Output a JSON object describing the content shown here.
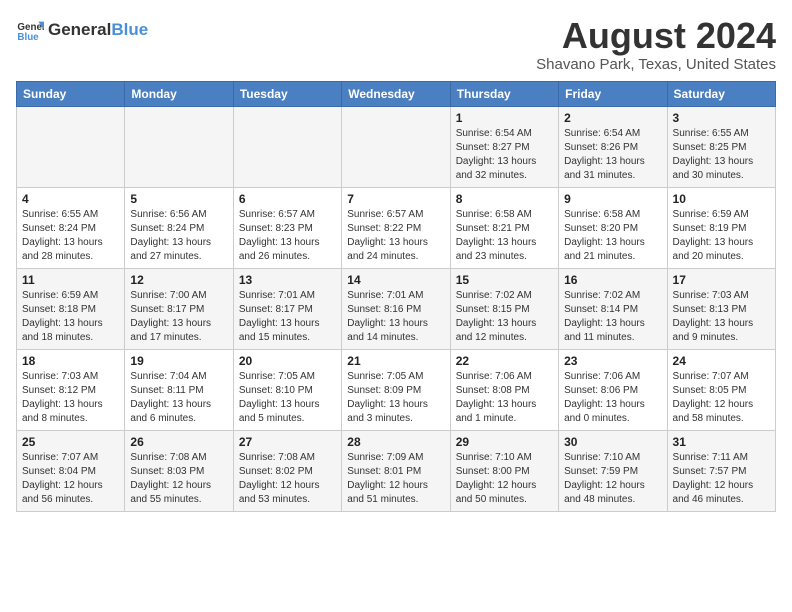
{
  "header": {
    "logo_general": "General",
    "logo_blue": "Blue",
    "title": "August 2024",
    "subtitle": "Shavano Park, Texas, United States"
  },
  "calendar": {
    "days_of_week": [
      "Sunday",
      "Monday",
      "Tuesday",
      "Wednesday",
      "Thursday",
      "Friday",
      "Saturday"
    ],
    "weeks": [
      [
        {
          "day": "",
          "detail": ""
        },
        {
          "day": "",
          "detail": ""
        },
        {
          "day": "",
          "detail": ""
        },
        {
          "day": "",
          "detail": ""
        },
        {
          "day": "1",
          "detail": "Sunrise: 6:54 AM\nSunset: 8:27 PM\nDaylight: 13 hours\nand 32 minutes."
        },
        {
          "day": "2",
          "detail": "Sunrise: 6:54 AM\nSunset: 8:26 PM\nDaylight: 13 hours\nand 31 minutes."
        },
        {
          "day": "3",
          "detail": "Sunrise: 6:55 AM\nSunset: 8:25 PM\nDaylight: 13 hours\nand 30 minutes."
        }
      ],
      [
        {
          "day": "4",
          "detail": "Sunrise: 6:55 AM\nSunset: 8:24 PM\nDaylight: 13 hours\nand 28 minutes."
        },
        {
          "day": "5",
          "detail": "Sunrise: 6:56 AM\nSunset: 8:24 PM\nDaylight: 13 hours\nand 27 minutes."
        },
        {
          "day": "6",
          "detail": "Sunrise: 6:57 AM\nSunset: 8:23 PM\nDaylight: 13 hours\nand 26 minutes."
        },
        {
          "day": "7",
          "detail": "Sunrise: 6:57 AM\nSunset: 8:22 PM\nDaylight: 13 hours\nand 24 minutes."
        },
        {
          "day": "8",
          "detail": "Sunrise: 6:58 AM\nSunset: 8:21 PM\nDaylight: 13 hours\nand 23 minutes."
        },
        {
          "day": "9",
          "detail": "Sunrise: 6:58 AM\nSunset: 8:20 PM\nDaylight: 13 hours\nand 21 minutes."
        },
        {
          "day": "10",
          "detail": "Sunrise: 6:59 AM\nSunset: 8:19 PM\nDaylight: 13 hours\nand 20 minutes."
        }
      ],
      [
        {
          "day": "11",
          "detail": "Sunrise: 6:59 AM\nSunset: 8:18 PM\nDaylight: 13 hours\nand 18 minutes."
        },
        {
          "day": "12",
          "detail": "Sunrise: 7:00 AM\nSunset: 8:17 PM\nDaylight: 13 hours\nand 17 minutes."
        },
        {
          "day": "13",
          "detail": "Sunrise: 7:01 AM\nSunset: 8:17 PM\nDaylight: 13 hours\nand 15 minutes."
        },
        {
          "day": "14",
          "detail": "Sunrise: 7:01 AM\nSunset: 8:16 PM\nDaylight: 13 hours\nand 14 minutes."
        },
        {
          "day": "15",
          "detail": "Sunrise: 7:02 AM\nSunset: 8:15 PM\nDaylight: 13 hours\nand 12 minutes."
        },
        {
          "day": "16",
          "detail": "Sunrise: 7:02 AM\nSunset: 8:14 PM\nDaylight: 13 hours\nand 11 minutes."
        },
        {
          "day": "17",
          "detail": "Sunrise: 7:03 AM\nSunset: 8:13 PM\nDaylight: 13 hours\nand 9 minutes."
        }
      ],
      [
        {
          "day": "18",
          "detail": "Sunrise: 7:03 AM\nSunset: 8:12 PM\nDaylight: 13 hours\nand 8 minutes."
        },
        {
          "day": "19",
          "detail": "Sunrise: 7:04 AM\nSunset: 8:11 PM\nDaylight: 13 hours\nand 6 minutes."
        },
        {
          "day": "20",
          "detail": "Sunrise: 7:05 AM\nSunset: 8:10 PM\nDaylight: 13 hours\nand 5 minutes."
        },
        {
          "day": "21",
          "detail": "Sunrise: 7:05 AM\nSunset: 8:09 PM\nDaylight: 13 hours\nand 3 minutes."
        },
        {
          "day": "22",
          "detail": "Sunrise: 7:06 AM\nSunset: 8:08 PM\nDaylight: 13 hours\nand 1 minute."
        },
        {
          "day": "23",
          "detail": "Sunrise: 7:06 AM\nSunset: 8:06 PM\nDaylight: 13 hours\nand 0 minutes."
        },
        {
          "day": "24",
          "detail": "Sunrise: 7:07 AM\nSunset: 8:05 PM\nDaylight: 12 hours\nand 58 minutes."
        }
      ],
      [
        {
          "day": "25",
          "detail": "Sunrise: 7:07 AM\nSunset: 8:04 PM\nDaylight: 12 hours\nand 56 minutes."
        },
        {
          "day": "26",
          "detail": "Sunrise: 7:08 AM\nSunset: 8:03 PM\nDaylight: 12 hours\nand 55 minutes."
        },
        {
          "day": "27",
          "detail": "Sunrise: 7:08 AM\nSunset: 8:02 PM\nDaylight: 12 hours\nand 53 minutes."
        },
        {
          "day": "28",
          "detail": "Sunrise: 7:09 AM\nSunset: 8:01 PM\nDaylight: 12 hours\nand 51 minutes."
        },
        {
          "day": "29",
          "detail": "Sunrise: 7:10 AM\nSunset: 8:00 PM\nDaylight: 12 hours\nand 50 minutes."
        },
        {
          "day": "30",
          "detail": "Sunrise: 7:10 AM\nSunset: 7:59 PM\nDaylight: 12 hours\nand 48 minutes."
        },
        {
          "day": "31",
          "detail": "Sunrise: 7:11 AM\nSunset: 7:57 PM\nDaylight: 12 hours\nand 46 minutes."
        }
      ]
    ]
  }
}
